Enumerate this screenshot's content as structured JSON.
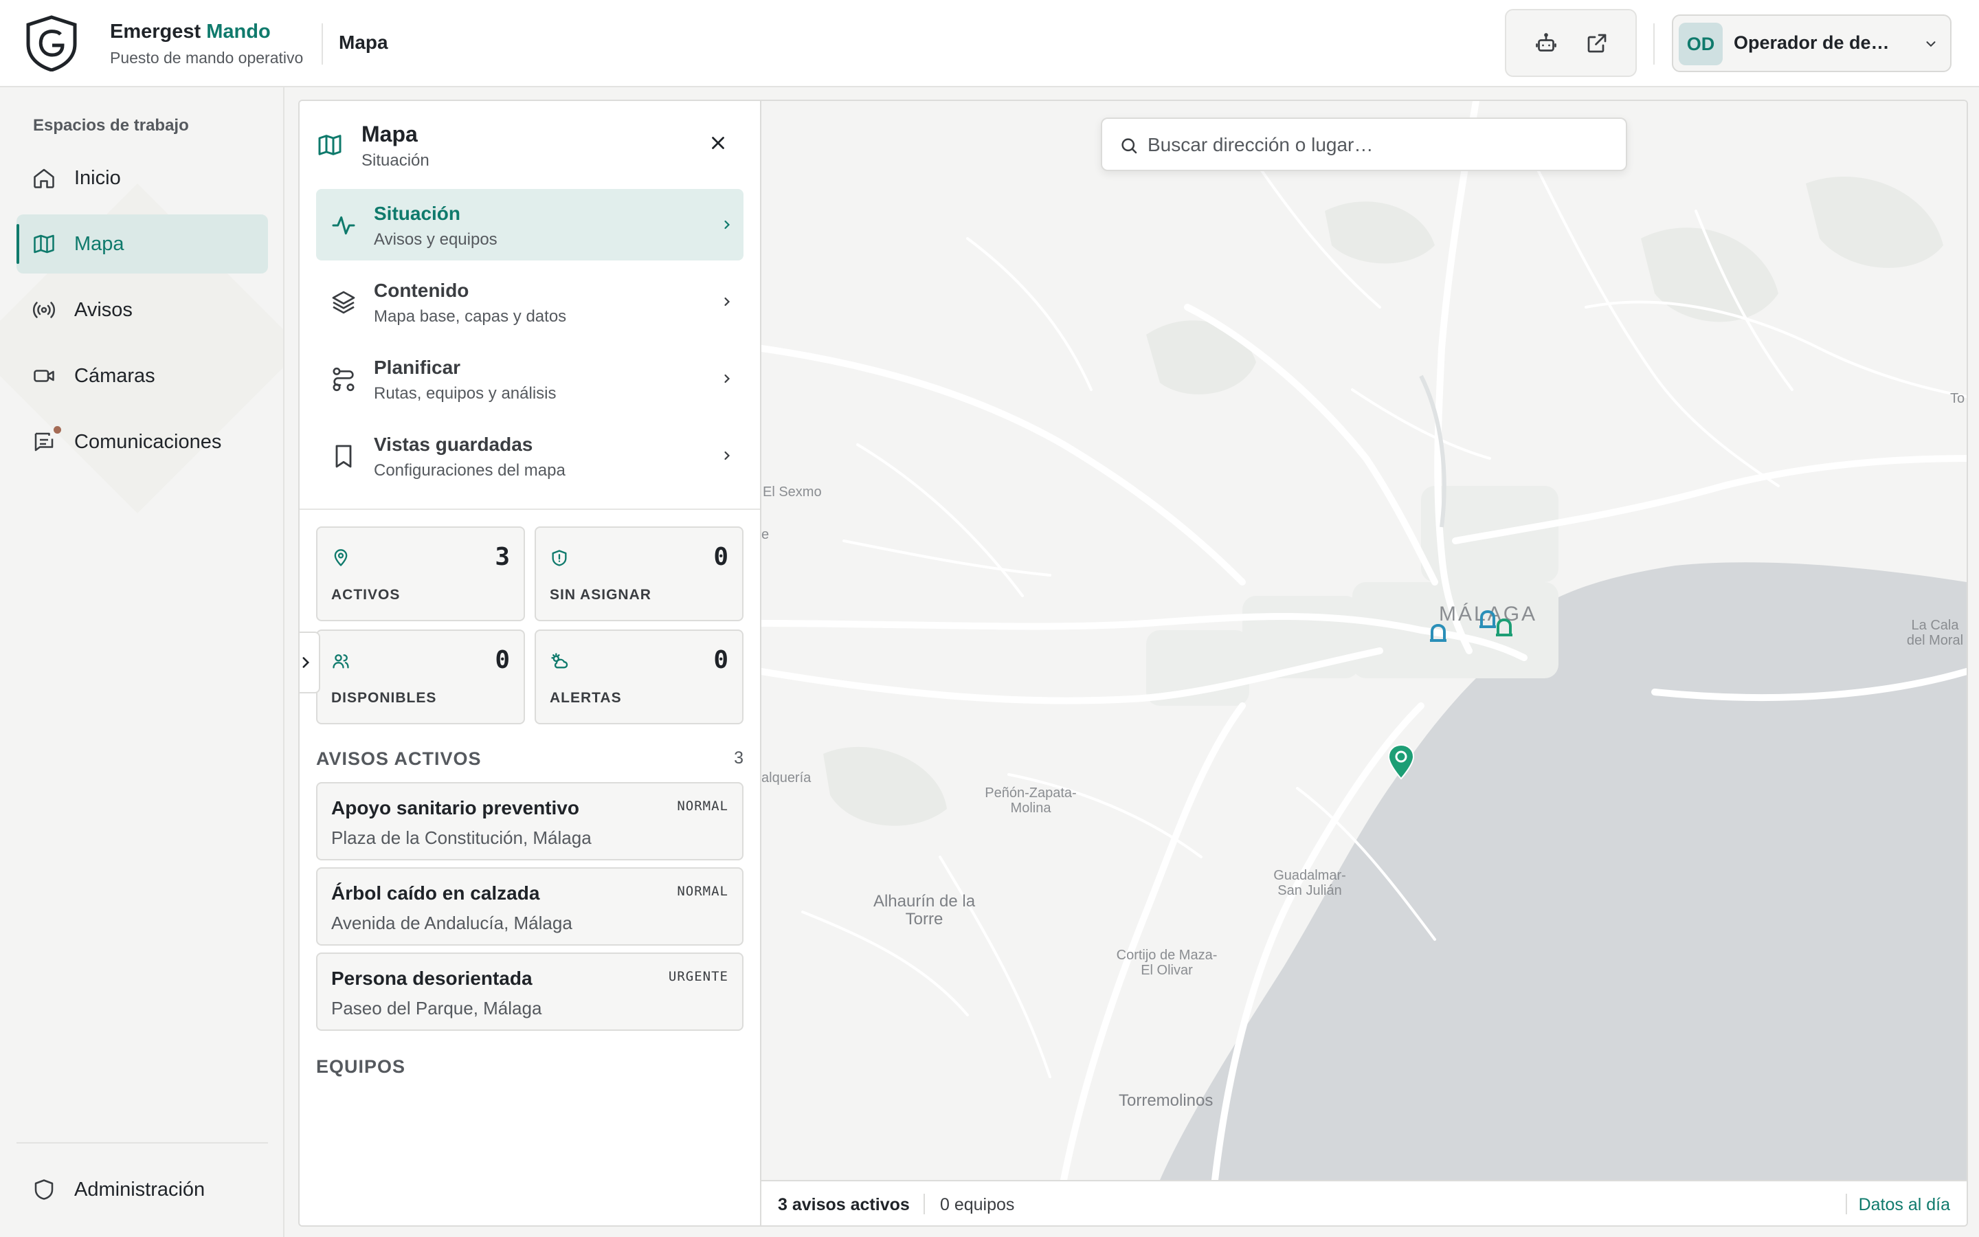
{
  "brand": {
    "name": "Emergest",
    "accent": "Mando",
    "subtitle": "Puesto de mando operativo",
    "color_accent": "#0f7a6c"
  },
  "header": {
    "page_title": "Mapa",
    "tools": [
      "robot-icon",
      "external-link-icon"
    ],
    "user": {
      "initials": "OD",
      "name": "Operador de dem…"
    }
  },
  "sidebar": {
    "section_label": "Espacios de trabajo",
    "items": [
      {
        "label": "Inicio",
        "icon": "home-icon",
        "active": false
      },
      {
        "label": "Mapa",
        "icon": "map-icon",
        "active": true
      },
      {
        "label": "Avisos",
        "icon": "broadcast-icon",
        "active": false
      },
      {
        "label": "Cámaras",
        "icon": "video-camera-icon",
        "active": false
      },
      {
        "label": "Comunicaciones",
        "icon": "message-icon",
        "active": false,
        "notification": true
      }
    ],
    "footer_item": {
      "label": "Administración",
      "icon": "shield-icon"
    }
  },
  "panel": {
    "title": "Mapa",
    "subtitle": "Situación",
    "menu": [
      {
        "title": "Situación",
        "desc": "Avisos y equipos",
        "icon": "activity-icon",
        "active": true
      },
      {
        "title": "Contenido",
        "desc": "Mapa base, capas y datos",
        "icon": "layers-icon",
        "active": false
      },
      {
        "title": "Planificar",
        "desc": "Rutas, equipos y análisis",
        "icon": "route-icon",
        "active": false
      },
      {
        "title": "Vistas guardadas",
        "desc": "Configuraciones del mapa",
        "icon": "bookmark-icon",
        "active": false
      }
    ],
    "stats": [
      {
        "label": "ACTIVOS",
        "value": "3",
        "icon": "map-pin-icon"
      },
      {
        "label": "SIN ASIGNAR",
        "value": "0",
        "icon": "shield-alert-icon"
      },
      {
        "label": "DISPONIBLES",
        "value": "0",
        "icon": "users-icon"
      },
      {
        "label": "ALERTAS",
        "value": "0",
        "icon": "weather-alert-icon"
      }
    ],
    "incidents_title": "AVISOS ACTIVOS",
    "incidents_count": "3",
    "incidents": [
      {
        "title": "Apoyo sanitario preventivo",
        "place": "Plaza de la Constitución, Málaga",
        "priority": "NORMAL"
      },
      {
        "title": "Árbol caído en calzada",
        "place": "Avenida de Andalucía, Málaga",
        "priority": "NORMAL"
      },
      {
        "title": "Persona desorientada",
        "place": "Paseo del Parque, Málaga",
        "priority": "URGENTE"
      }
    ],
    "teams_title": "EQUIPOS"
  },
  "map": {
    "search_placeholder": "Buscar dirección o lugar…",
    "places": {
      "sexmo": "El Sexmo",
      "malaga": "MÁLAGA",
      "cala": "La Cala del Moral",
      "alqueria": "alquería",
      "penon": "Peñón-Zapata-Molina",
      "alhaurin": "Alhaurín de la Torre",
      "guadalmar": "Guadalmar-San Julián",
      "cortijo": "Cortijo de Maza-El Olivar",
      "torremolinos": "Torremolinos",
      "edge_e": "e",
      "edge_to": "To"
    },
    "colors": {
      "sea": "#d4d7da",
      "land": "#f4f4f3",
      "roads": "#ffffff",
      "marker": "#1d9e75",
      "vehicle": "#2a8fb8"
    }
  },
  "statusbar": {
    "active": "3 avisos activos",
    "teams": "0 equipos",
    "data": "Datos al día"
  }
}
